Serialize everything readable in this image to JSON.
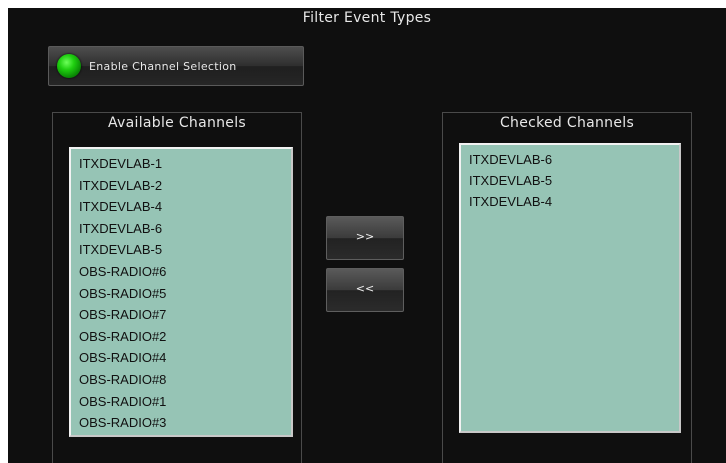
{
  "window": {
    "title": "Filter Event Types"
  },
  "enable_channel_selection": {
    "label": "Enable Channel Selection",
    "led_color": "#1fcf10"
  },
  "available_channels": {
    "title": "Available Channels",
    "items": [
      "ITXDEVLAB-1",
      "ITXDEVLAB-2",
      "ITXDEVLAB-4",
      "ITXDEVLAB-6",
      "ITXDEVLAB-5",
      "OBS-RADIO#6",
      "OBS-RADIO#5",
      "OBS-RADIO#7",
      "OBS-RADIO#2",
      "OBS-RADIO#4",
      "OBS-RADIO#8",
      "OBS-RADIO#1",
      "OBS-RADIO#3"
    ]
  },
  "checked_channels": {
    "title": "Checked Channels",
    "items": [
      "ITXDEVLAB-6",
      "ITXDEVLAB-5",
      "ITXDEVLAB-4"
    ]
  },
  "buttons": {
    "add_label": ">>",
    "remove_label": "<<"
  },
  "colors": {
    "list_background": "#96c4b5",
    "window_background": "#0f0f0f"
  }
}
